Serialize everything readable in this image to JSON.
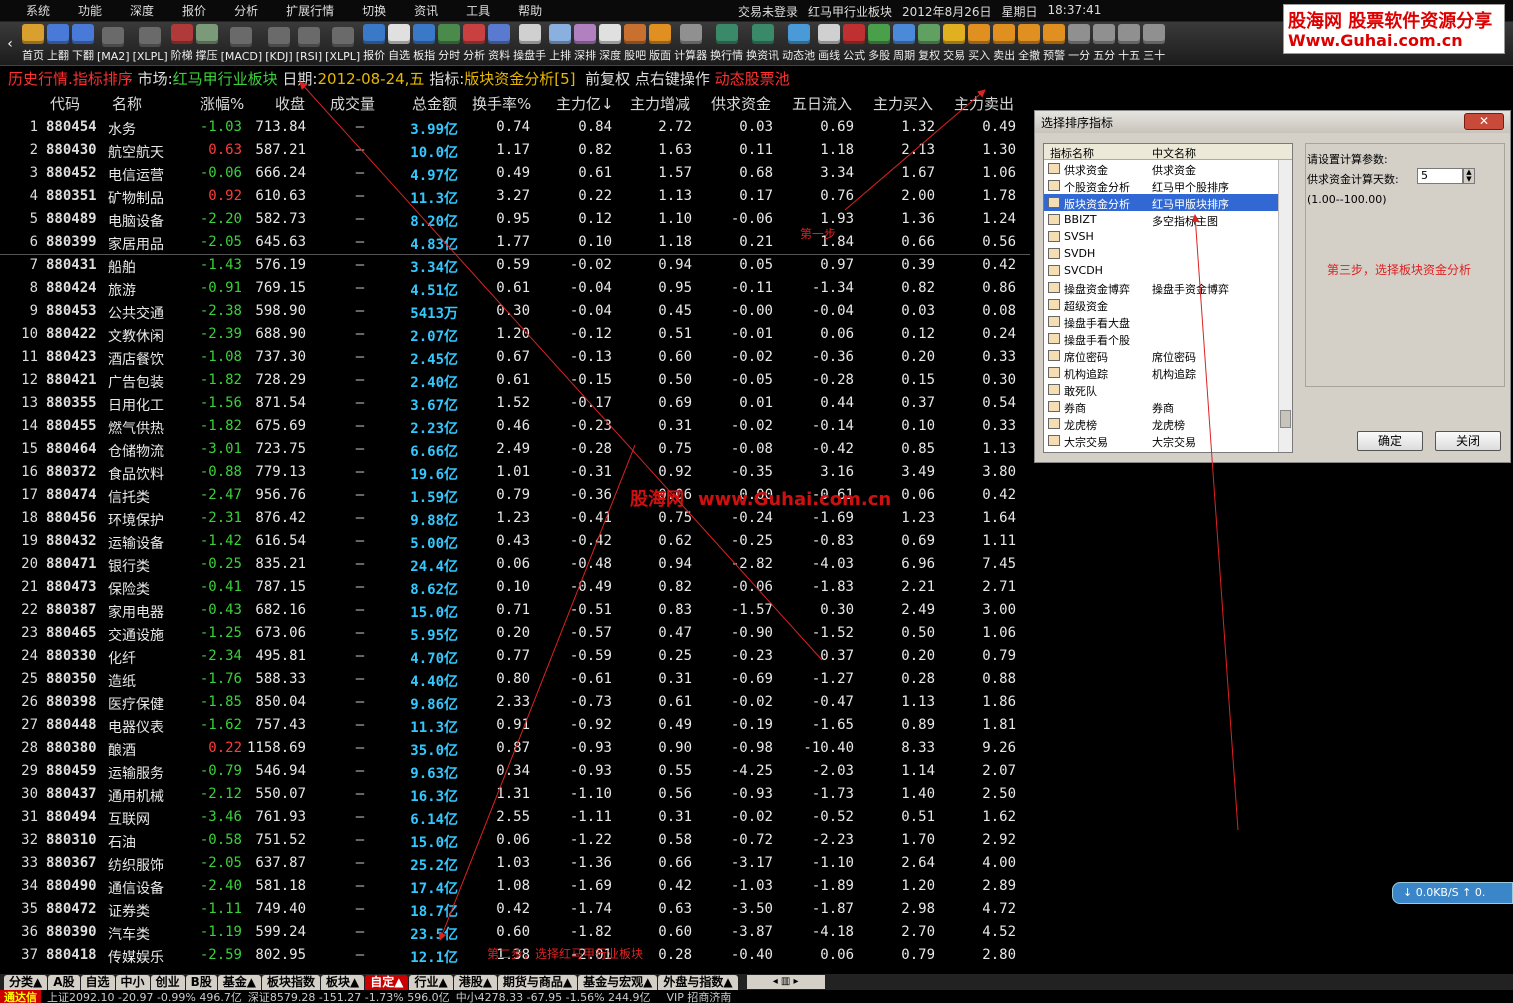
{
  "menu": [
    "系统",
    "功能",
    "深度",
    "报价",
    "分析",
    "扩展行情",
    "切换",
    "资讯",
    "工具",
    "帮助"
  ],
  "title": {
    "trade_status": "交易未登录",
    "window": "红马甲行业板块",
    "date": "2012年8月26日",
    "weekday": "星期日",
    "time": "18:37:41"
  },
  "toolbar": [
    {
      "label": "首页",
      "color": "#d9a030"
    },
    {
      "label": "上翻",
      "color": "#4a7ad8"
    },
    {
      "label": "下翻",
      "color": "#4a7ad8"
    },
    {
      "label": "[MA2]",
      "color": "#6a6a6a"
    },
    {
      "label": "[XLPL]",
      "color": "#6a6a6a"
    },
    {
      "label": "阶梯",
      "color": "#b03a3a"
    },
    {
      "label": "撑压",
      "color": "#7a9a7a"
    },
    {
      "label": "[MACD]",
      "color": "#6a6a6a"
    },
    {
      "label": "[KDJ]",
      "color": "#6a6a6a"
    },
    {
      "label": "[RSI]",
      "color": "#6a6a6a"
    },
    {
      "label": "[XLPL]",
      "color": "#6a6a6a"
    },
    {
      "label": "报价",
      "color": "#3a78c8"
    },
    {
      "label": "自选",
      "color": "#e0e0e0"
    },
    {
      "label": "板指",
      "color": "#3a78c8"
    },
    {
      "label": "分时",
      "color": "#4a8a4a"
    },
    {
      "label": "分析",
      "color": "#c84040"
    },
    {
      "label": "资料",
      "color": "#5a7ad0"
    },
    {
      "label": "操盘手",
      "color": "#d0d0d0"
    },
    {
      "label": "上排",
      "color": "#8ab0e0"
    },
    {
      "label": "深排",
      "color": "#b080c0"
    },
    {
      "label": "深度",
      "color": "#e0e0e0"
    },
    {
      "label": "股吧",
      "color": "#c87030"
    },
    {
      "label": "版面",
      "color": "#e09020"
    },
    {
      "label": "计算器",
      "color": "#909090"
    },
    {
      "label": "换行情",
      "color": "#3a8a6a"
    },
    {
      "label": "换资讯",
      "color": "#3a8a6a"
    },
    {
      "label": "动态池",
      "color": "#4a9ad8"
    },
    {
      "label": "画线",
      "color": "#d0d0d0"
    },
    {
      "label": "公式",
      "color": "#c03030"
    },
    {
      "label": "多股",
      "color": "#4aa04a"
    },
    {
      "label": "周期",
      "color": "#4a8ad8"
    },
    {
      "label": "复权",
      "color": "#60a060"
    },
    {
      "label": "交易",
      "color": "#e0b020"
    },
    {
      "label": "买入",
      "color": "#e09020"
    },
    {
      "label": "卖出",
      "color": "#e09020"
    },
    {
      "label": "全撤",
      "color": "#e09020"
    },
    {
      "label": "预警",
      "color": "#e09020"
    },
    {
      "label": "一分",
      "color": "#909090"
    },
    {
      "label": "五分",
      "color": "#909090"
    },
    {
      "label": "十五",
      "color": "#909090"
    },
    {
      "label": "三十",
      "color": "#909090"
    }
  ],
  "ad": {
    "line1": "股海网 股票软件资源分享",
    "line2": "Www.Guhai.com.cn"
  },
  "infobar": {
    "mode": "历史行情.指标排序",
    "market_label": "市场:",
    "market": "红马甲行业板块",
    "date_label": "日期:",
    "date": "2012-08-24,五",
    "indicator_label": "指标:",
    "indicator": "版块资金分析[5]",
    "fq": "前复权",
    "hint": "点右键操作",
    "pool": "动态股票池"
  },
  "columns": [
    "代码",
    "名称",
    "涨幅%",
    "收盘",
    "成交量",
    "总金额",
    "换手率%",
    "主力亿↓",
    "主力增减",
    "供求资金",
    "五日流入",
    "主力买入",
    "主力卖出"
  ],
  "rows": [
    [
      "1",
      "880454",
      "水务",
      "-1.03",
      "713.84",
      "—",
      "3.99亿",
      "0.74",
      "0.84",
      "2.72",
      "0.03",
      "0.69",
      "1.32",
      "0.49"
    ],
    [
      "2",
      "880430",
      "航空航天",
      "0.63",
      "587.21",
      "—",
      "10.0亿",
      "1.17",
      "0.82",
      "1.63",
      "0.11",
      "1.18",
      "2.13",
      "1.30"
    ],
    [
      "3",
      "880452",
      "电信运营",
      "-0.06",
      "666.24",
      "—",
      "4.97亿",
      "0.49",
      "0.61",
      "1.57",
      "0.68",
      "3.34",
      "1.67",
      "1.06"
    ],
    [
      "4",
      "880351",
      "矿物制品",
      "0.92",
      "610.63",
      "—",
      "11.3亿",
      "3.27",
      "0.22",
      "1.13",
      "0.17",
      "0.76",
      "2.00",
      "1.78"
    ],
    [
      "5",
      "880489",
      "电脑设备",
      "-2.20",
      "582.73",
      "—",
      "8.20亿",
      "0.95",
      "0.12",
      "1.10",
      "-0.06",
      "1.93",
      "1.36",
      "1.24"
    ],
    [
      "6",
      "880399",
      "家居用品",
      "-2.05",
      "645.63",
      "—",
      "4.83亿",
      "1.77",
      "0.10",
      "1.18",
      "0.21",
      "1.84",
      "0.66",
      "0.56"
    ],
    [
      "7",
      "880431",
      "船舶",
      "-1.43",
      "576.19",
      "—",
      "3.34亿",
      "0.59",
      "-0.02",
      "0.94",
      "0.05",
      "0.97",
      "0.39",
      "0.42"
    ],
    [
      "8",
      "880424",
      "旅游",
      "-0.91",
      "769.15",
      "—",
      "4.51亿",
      "0.61",
      "-0.04",
      "0.95",
      "-0.11",
      "-1.34",
      "0.82",
      "0.86"
    ],
    [
      "9",
      "880453",
      "公共交通",
      "-2.38",
      "598.90",
      "—",
      "5413万",
      "0.30",
      "-0.04",
      "0.45",
      "-0.00",
      "-0.04",
      "0.03",
      "0.08"
    ],
    [
      "10",
      "880422",
      "文教休闲",
      "-2.39",
      "688.90",
      "—",
      "2.07亿",
      "1.20",
      "-0.12",
      "0.51",
      "-0.01",
      "0.06",
      "0.12",
      "0.24"
    ],
    [
      "11",
      "880423",
      "酒店餐饮",
      "-1.08",
      "737.30",
      "—",
      "2.45亿",
      "0.67",
      "-0.13",
      "0.60",
      "-0.02",
      "-0.36",
      "0.20",
      "0.33"
    ],
    [
      "12",
      "880421",
      "广告包装",
      "-1.82",
      "728.29",
      "—",
      "2.40亿",
      "0.61",
      "-0.15",
      "0.50",
      "-0.05",
      "-0.28",
      "0.15",
      "0.30"
    ],
    [
      "13",
      "880355",
      "日用化工",
      "-1.56",
      "871.54",
      "—",
      "3.67亿",
      "1.52",
      "-0.17",
      "0.69",
      "0.01",
      "0.44",
      "0.37",
      "0.54"
    ],
    [
      "14",
      "880455",
      "燃气供热",
      "-1.82",
      "675.69",
      "—",
      "2.23亿",
      "0.46",
      "-0.23",
      "0.31",
      "-0.02",
      "-0.14",
      "0.10",
      "0.33"
    ],
    [
      "15",
      "880464",
      "仓储物流",
      "-3.01",
      "723.75",
      "—",
      "6.66亿",
      "2.49",
      "-0.28",
      "0.75",
      "-0.08",
      "-0.42",
      "0.85",
      "1.13"
    ],
    [
      "16",
      "880372",
      "食品饮料",
      "-0.88",
      "779.13",
      "—",
      "19.6亿",
      "1.01",
      "-0.31",
      "0.92",
      "-0.35",
      "3.16",
      "3.49",
      "3.80"
    ],
    [
      "17",
      "880474",
      "信托类",
      "-2.47",
      "956.76",
      "—",
      "1.59亿",
      "0.79",
      "-0.36",
      "0.06",
      "0.00",
      "-0.61",
      "0.06",
      "0.42"
    ],
    [
      "18",
      "880456",
      "环境保护",
      "-2.31",
      "876.42",
      "—",
      "9.88亿",
      "1.23",
      "-0.41",
      "0.75",
      "-0.24",
      "-1.69",
      "1.23",
      "1.64"
    ],
    [
      "19",
      "880432",
      "运输设备",
      "-1.42",
      "616.54",
      "—",
      "5.00亿",
      "0.43",
      "-0.42",
      "0.62",
      "-0.25",
      "-0.83",
      "0.69",
      "1.11"
    ],
    [
      "20",
      "880471",
      "银行类",
      "-0.25",
      "835.21",
      "—",
      "24.4亿",
      "0.06",
      "-0.48",
      "0.94",
      "-2.82",
      "-4.03",
      "6.96",
      "7.45"
    ],
    [
      "21",
      "880473",
      "保险类",
      "-0.41",
      "787.15",
      "—",
      "8.62亿",
      "0.10",
      "-0.49",
      "0.82",
      "-0.06",
      "-1.83",
      "2.21",
      "2.71"
    ],
    [
      "22",
      "880387",
      "家用电器",
      "-0.43",
      "682.16",
      "—",
      "15.0亿",
      "0.71",
      "-0.51",
      "0.83",
      "-1.57",
      "0.30",
      "2.49",
      "3.00"
    ],
    [
      "23",
      "880465",
      "交通设施",
      "-1.25",
      "673.06",
      "—",
      "5.95亿",
      "0.20",
      "-0.57",
      "0.47",
      "-0.90",
      "-1.52",
      "0.50",
      "1.06"
    ],
    [
      "24",
      "880330",
      "化纤",
      "-2.34",
      "495.81",
      "—",
      "4.70亿",
      "0.77",
      "-0.59",
      "0.25",
      "-0.23",
      "0.37",
      "0.20",
      "0.79"
    ],
    [
      "25",
      "880350",
      "造纸",
      "-1.76",
      "588.33",
      "—",
      "4.40亿",
      "0.80",
      "-0.61",
      "0.31",
      "-0.69",
      "-1.27",
      "0.28",
      "0.88"
    ],
    [
      "26",
      "880398",
      "医疗保健",
      "-1.85",
      "850.04",
      "—",
      "9.86亿",
      "2.33",
      "-0.73",
      "0.61",
      "-0.02",
      "-0.47",
      "1.13",
      "1.86"
    ],
    [
      "27",
      "880448",
      "电器仪表",
      "-1.62",
      "757.43",
      "—",
      "11.3亿",
      "0.91",
      "-0.92",
      "0.49",
      "-0.19",
      "-1.65",
      "0.89",
      "1.81"
    ],
    [
      "28",
      "880380",
      "酿酒",
      "0.22",
      "1158.69",
      "—",
      "35.0亿",
      "0.87",
      "-0.93",
      "0.90",
      "-0.98",
      "-10.40",
      "8.33",
      "9.26"
    ],
    [
      "29",
      "880459",
      "运输服务",
      "-0.79",
      "546.94",
      "—",
      "9.63亿",
      "0.34",
      "-0.93",
      "0.55",
      "-4.25",
      "-2.03",
      "1.14",
      "2.07"
    ],
    [
      "30",
      "880437",
      "通用机械",
      "-2.12",
      "550.07",
      "—",
      "16.3亿",
      "1.31",
      "-1.10",
      "0.56",
      "-0.93",
      "-1.73",
      "1.40",
      "2.50"
    ],
    [
      "31",
      "880494",
      "互联网",
      "-3.46",
      "761.93",
      "—",
      "6.14亿",
      "2.55",
      "-1.11",
      "0.31",
      "-0.02",
      "-0.52",
      "0.51",
      "1.62"
    ],
    [
      "32",
      "880310",
      "石油",
      "-0.58",
      "751.52",
      "—",
      "15.0亿",
      "0.06",
      "-1.22",
      "0.58",
      "-0.72",
      "-2.23",
      "1.70",
      "2.92"
    ],
    [
      "33",
      "880367",
      "纺织服饰",
      "-2.05",
      "637.87",
      "—",
      "25.2亿",
      "1.03",
      "-1.36",
      "0.66",
      "-3.17",
      "-1.10",
      "2.64",
      "4.00"
    ],
    [
      "34",
      "880490",
      "通信设备",
      "-2.40",
      "581.18",
      "—",
      "17.4亿",
      "1.08",
      "-1.69",
      "0.42",
      "-1.03",
      "-1.89",
      "1.20",
      "2.89"
    ],
    [
      "35",
      "880472",
      "证券类",
      "-1.11",
      "749.40",
      "—",
      "18.7亿",
      "0.42",
      "-1.74",
      "0.63",
      "-3.50",
      "-1.87",
      "2.98",
      "4.72"
    ],
    [
      "36",
      "880390",
      "汽车类",
      "-1.19",
      "599.24",
      "—",
      "23.5亿",
      "0.60",
      "-1.82",
      "0.60",
      "-3.87",
      "-4.18",
      "2.70",
      "4.52"
    ],
    [
      "37",
      "880418",
      "传媒娱乐",
      "-2.59",
      "802.95",
      "—",
      "12.1亿",
      "1.38",
      "-2.01",
      "0.28",
      "-0.40",
      "0.06",
      "0.79",
      "2.80"
    ]
  ],
  "dialog": {
    "title": "选择排序指标",
    "close": "✕",
    "list_hdr_a": "指标名称",
    "list_hdr_b": "中文名称",
    "items": [
      [
        "供求资金",
        "供求资金"
      ],
      [
        "个股资金分析",
        "红马甲个股排序"
      ],
      [
        "版块资金分析",
        "红马甲版块排序"
      ],
      [
        "BBIZT",
        "多空指标主图"
      ],
      [
        "SVSH",
        ""
      ],
      [
        "SVDH",
        ""
      ],
      [
        "SVCDH",
        ""
      ],
      [
        "操盘资金博弈",
        "操盘手资金博弈"
      ],
      [
        "超级资金",
        ""
      ],
      [
        "操盘手看大盘",
        ""
      ],
      [
        "操盘手看个股",
        ""
      ],
      [
        "席位密码",
        "席位密码"
      ],
      [
        "机构追踪",
        "机构追踪"
      ],
      [
        "敢死队",
        ""
      ],
      [
        "券商",
        "券商"
      ],
      [
        "龙虎榜",
        "龙虎榜"
      ],
      [
        "大宗交易",
        "大宗交易"
      ]
    ],
    "param_title": "请设置计算参数:",
    "param_label": "供求资金计算天数:",
    "param_value": "5",
    "param_range": "(1.00--100.00)",
    "note3": "第三步，选择板块资金分析",
    "ok": "确定",
    "cancel": "关闭"
  },
  "notes": {
    "step1": "第一步",
    "step2": "第二步，选择红马甲行业板块"
  },
  "watermark": {
    "a": "股海网",
    "b": "www.Guhai.com.cn"
  },
  "netspeed": "↓ 0.0KB/S  ↑ 0.",
  "tabs": [
    "分类▲",
    "A股",
    "自选",
    "中小",
    "创业",
    "B股",
    "基金▲",
    "板块指数",
    "板块▲",
    "自定▲",
    "行业▲",
    "港股▲",
    "期货与商品▲",
    "基金与宏观▲",
    "外盘与指数▲"
  ],
  "tab_active_index": 9,
  "status": {
    "brand": "通达信",
    "sh": "上证2092.10 -20.97 -0.99% 496.7亿",
    "sz": "深证8579.28 -151.27 -1.73% 596.0亿",
    "zx": "中小4278.33 -67.95 -1.56% 244.9亿",
    "vip": "VIP  招商济南"
  },
  "colors": {
    "up": "#ff3b3b",
    "down": "#3ad13a",
    "amount": "#33c8ff",
    "accent_yellow": "#e8b800",
    "annotation": "#dd2222"
  }
}
